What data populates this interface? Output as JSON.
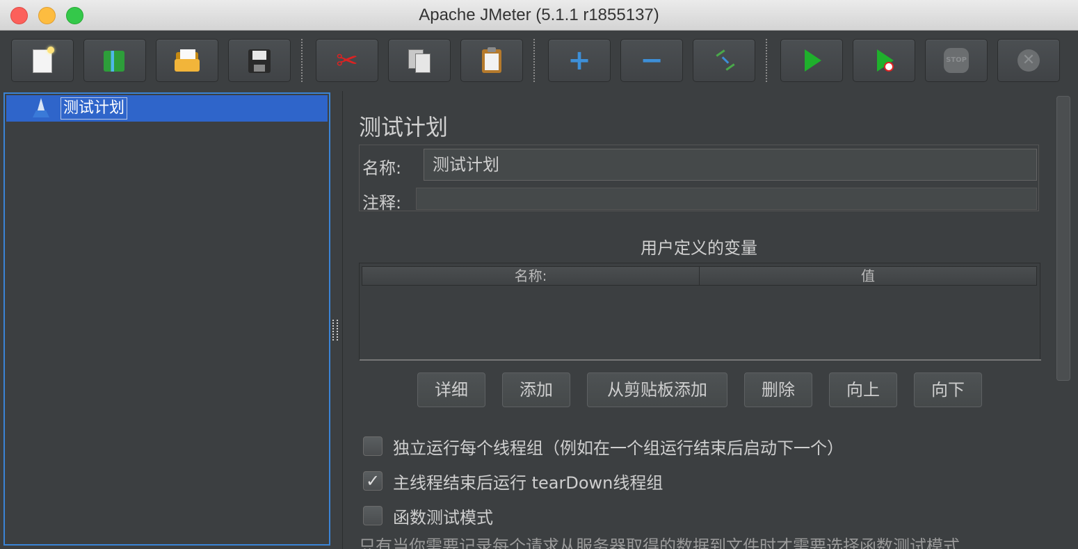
{
  "window": {
    "title": "Apache JMeter (5.1.1 r1855137)"
  },
  "toolbar": {
    "buttons": [
      {
        "icon": "new-document-icon"
      },
      {
        "icon": "templates-icon"
      },
      {
        "icon": "open-folder-icon"
      },
      {
        "icon": "save-disk-icon"
      },
      {
        "icon": "cut-scissors-icon"
      },
      {
        "icon": "copy-icon"
      },
      {
        "icon": "paste-clipboard-icon"
      },
      {
        "icon": "expand-all-plus-icon"
      },
      {
        "icon": "collapse-all-minus-icon"
      },
      {
        "icon": "toggle-icon"
      },
      {
        "icon": "start-play-icon"
      },
      {
        "icon": "start-no-pauses-icon"
      },
      {
        "icon": "stop-icon"
      },
      {
        "icon": "shutdown-icon"
      }
    ],
    "glyphs": {
      "plus": "+",
      "minus": "−",
      "stop": "STOP",
      "shutdown": "✕",
      "cut": "✂"
    }
  },
  "tree": {
    "selected_item": "测试计划"
  },
  "test_plan": {
    "heading": "测试计划",
    "name_label": "名称:",
    "name_value": "测试计划",
    "comment_label": "注释:",
    "comment_value": "",
    "variables_title": "用户定义的变量",
    "table_headers": [
      "名称:",
      "值"
    ],
    "buttons": [
      "详细",
      "添加",
      "从剪贴板添加",
      "删除",
      "向上",
      "向下"
    ],
    "options": [
      {
        "label": "独立运行每个线程组（例如在一个组运行结束后启动下一个）",
        "checked": false
      },
      {
        "label": "主线程结束后运行 tearDown线程组",
        "checked": true
      },
      {
        "label": "函数测试模式",
        "checked": false
      }
    ],
    "check_glyph": "✓",
    "truncated_note": "只有当你需要记录每个请求从服务器取得的数据到文件时才需要选择函数测试模式"
  },
  "colors": {
    "background": "#3c3f41",
    "selection": "#2f65ca",
    "tree_border": "#3b84d6",
    "play_green": "#1fb02c",
    "accent_blue": "#3d8fd8"
  }
}
